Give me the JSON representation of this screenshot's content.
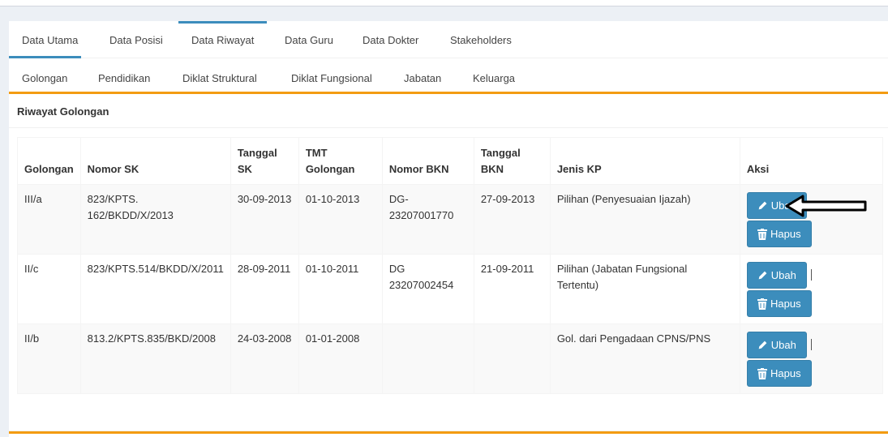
{
  "tabs_main": [
    "Data Utama",
    "Data Posisi",
    "Data Riwayat",
    "Data Guru",
    "Data Dokter",
    "Stakeholders"
  ],
  "tabs_sub": [
    "Golongan",
    "Pendidikan",
    "Diklat Struktural",
    "Diklat Fungsional",
    "Jabatan",
    "Keluarga"
  ],
  "section_title": "Riwayat Golongan",
  "table": {
    "headers": [
      "Golongan",
      "Nomor SK",
      "Tanggal SK",
      "TMT Golongan",
      "Nomor BKN",
      "Tanggal BKN",
      "Jenis KP",
      "Aksi"
    ],
    "rows": [
      {
        "golongan": "III/a",
        "nomor_sk": "823/KPTS. 162/BKDD/X/2013",
        "tanggal_sk": "30-09-2013",
        "tmt": "01-10-2013",
        "nomor_bkn": "DG- 23207001770",
        "tanggal_bkn": "27-09-2013",
        "jenis_kp": "Pilihan (Penyesuaian Ijazah)"
      },
      {
        "golongan": "II/c",
        "nomor_sk": "823/KPTS.514/BKDD/X/2011",
        "tanggal_sk": "28-09-2011",
        "tmt": "01-10-2011",
        "nomor_bkn": "DG 23207002454",
        "tanggal_bkn": "21-09-2011",
        "jenis_kp": "Pilihan (Jabatan Fungsional Tertentu)"
      },
      {
        "golongan": "II/b",
        "nomor_sk": "813.2/KPTS.835/BKD/2008",
        "tanggal_sk": "24-03-2008",
        "tmt": "01-01-2008",
        "nomor_bkn": "",
        "tanggal_bkn": "",
        "jenis_kp": "Gol. dari Pengadaan CPNS/PNS"
      }
    ]
  },
  "buttons": {
    "ubah": "Ubah",
    "hapus": "Hapus"
  },
  "icons": {
    "edit": "pencil-icon",
    "delete": "trash-icon",
    "annotation": "arrow-left-icon"
  },
  "colors": {
    "primary": "#3c8dbc",
    "accent": "#f39c12"
  }
}
